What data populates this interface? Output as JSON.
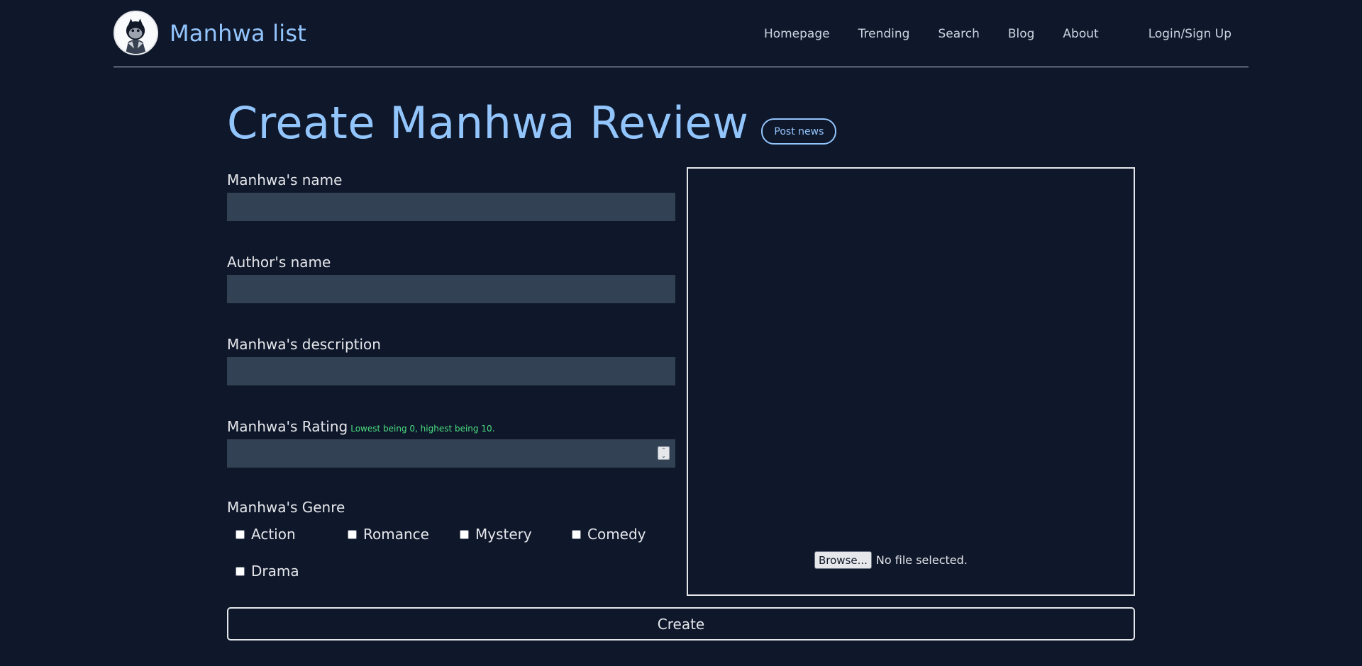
{
  "brand": {
    "title": "Manhwa list"
  },
  "nav": {
    "links": [
      "Homepage",
      "Trending",
      "Search",
      "Blog",
      "About"
    ],
    "login": "Login/Sign Up"
  },
  "page": {
    "title": "Create Manhwa Review",
    "post_news": "Post news"
  },
  "form": {
    "name_label": "Manhwa's name",
    "author_label": "Author's name",
    "description_label": "Manhwa's description",
    "rating_label": "Manhwa's Rating",
    "rating_hint": "Lowest being 0, highest being 10.",
    "genre_label": "Manhwa's Genre",
    "genres": [
      "Action",
      "Romance",
      "Mystery",
      "Comedy",
      "Drama"
    ],
    "create": "Create"
  },
  "upload": {
    "browse": "Browse...",
    "status": "No file selected."
  },
  "colors": {
    "background": "#0f172a",
    "accent": "#93c5fd",
    "input": "#334155",
    "hint": "#4ade80"
  }
}
